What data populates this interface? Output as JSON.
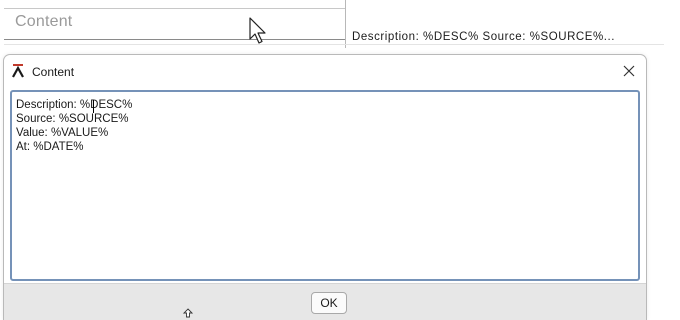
{
  "property_row": {
    "label": "Content",
    "value": "Description: %DESC% Source: %SOURCE%..."
  },
  "dialog": {
    "title": "Content",
    "close_symbol": "×",
    "icon": "app-logo-icon",
    "text_lines": [
      "Description: %DESC%",
      "Source: %SOURCE%",
      "Value: %VALUE%",
      "At: %DATE%"
    ],
    "ok_label": "OK"
  },
  "colors": {
    "text_area_border": "#7592b8",
    "footer_bg": "#e7e7e7",
    "title_icon_red": "#c0392b"
  }
}
